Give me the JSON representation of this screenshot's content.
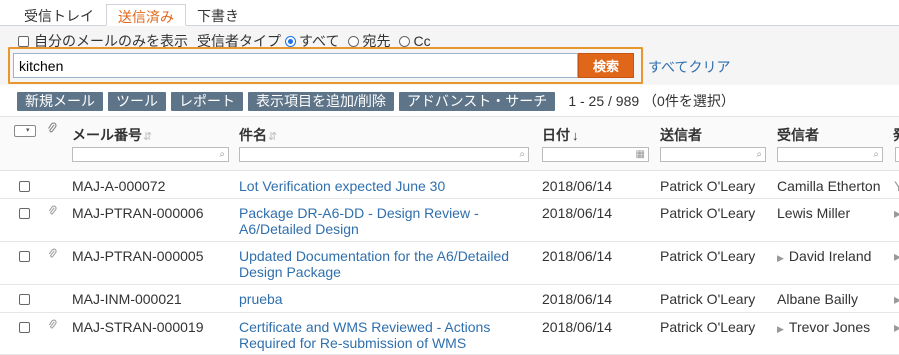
{
  "tabs": [
    {
      "label": "受信トレイ",
      "active": false
    },
    {
      "label": "送信済み",
      "active": true
    },
    {
      "label": "下書き",
      "active": false
    }
  ],
  "filters": {
    "own_mail_only": "自分のメールのみを表示",
    "recipient_type_label": "受信者タイプ",
    "radio_all": "すべて",
    "radio_to": "宛先",
    "radio_cc": "Cc"
  },
  "search": {
    "value": "kitchen",
    "button": "検索",
    "clear_all": "すべてクリア"
  },
  "toolbar": {
    "new_mail": "新規メール",
    "tools": "ツール",
    "reports": "レポート",
    "add_remove_columns": "表示項目を追加/削除",
    "advanced_search": "アドバンスト・サーチ",
    "count": "1 - 25 / 989 （0件を選択）"
  },
  "columns": {
    "mail_number": "メール番号",
    "subject": "件名",
    "date": "日付",
    "sender": "送信者",
    "recipient": "受信者"
  },
  "rows": [
    {
      "id": "MAJ-A-000072",
      "subject": "Lot Verification expected June 30",
      "date": "2018/06/14",
      "sender": "Patrick O'Leary",
      "recipient": "Camilla Etherton",
      "attachment": false,
      "expand": false,
      "extra": "Y"
    },
    {
      "id": "MAJ-PTRAN-000006",
      "subject": "Package DR-A6-DD - Design Review - A6/Detailed Design",
      "date": "2018/06/14",
      "sender": "Patrick O'Leary",
      "recipient": "Lewis Miller",
      "attachment": true,
      "expand": false,
      "extra": "▸"
    },
    {
      "id": "MAJ-PTRAN-000005",
      "subject": "Updated Documentation for the A6/Detailed Design Package",
      "date": "2018/06/14",
      "sender": "Patrick O'Leary",
      "recipient": "David Ireland",
      "attachment": true,
      "expand": true,
      "extra": "▸"
    },
    {
      "id": "MAJ-INM-000021",
      "subject": "prueba",
      "date": "2018/06/14",
      "sender": "Patrick O'Leary",
      "recipient": "Albane Bailly",
      "attachment": false,
      "expand": false,
      "extra": "▸"
    },
    {
      "id": "MAJ-STRAN-000019",
      "subject": "Certificate and WMS Reviewed - Actions Required for Re-submission of WMS",
      "date": "2018/06/14",
      "sender": "Patrick O'Leary",
      "recipient": "Trevor Jones",
      "attachment": true,
      "expand": true,
      "extra": "▸"
    }
  ]
}
